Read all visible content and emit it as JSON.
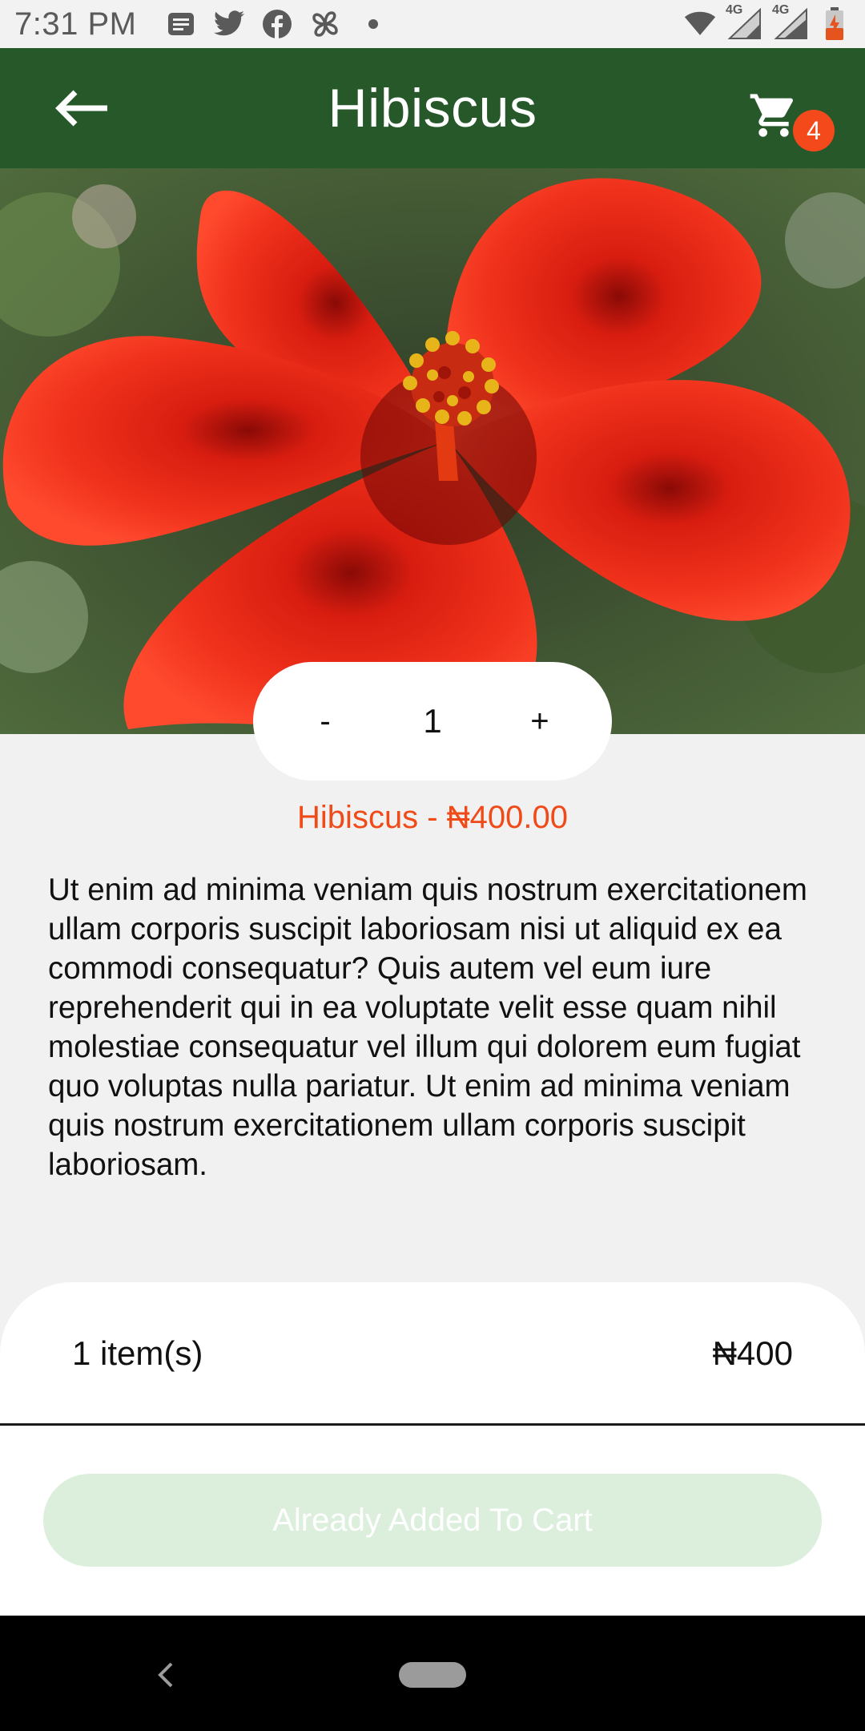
{
  "status_bar": {
    "time": "7:31 PM",
    "network_labels": [
      "4G",
      "4G"
    ],
    "icons": [
      "news-icon",
      "twitter-icon",
      "facebook-icon",
      "pinwheel-icon",
      "dot-icon",
      "wifi-icon",
      "signal-icon",
      "signal-icon",
      "battery-icon"
    ]
  },
  "app_bar": {
    "title": "Hibiscus",
    "cart_count": "4",
    "back_icon": "arrow-left-icon",
    "cart_icon": "shopping-cart-icon"
  },
  "quantity": {
    "decrement_label": "-",
    "value": "1",
    "increment_label": "+"
  },
  "product": {
    "title_price": "Hibiscus - ₦400.00",
    "description": "Ut enim ad minima veniam quis nostrum exercitationem ullam corporis suscipit laboriosam nisi ut aliquid ex ea commodi consequatur? Quis autem vel eum iure reprehenderit qui in ea voluptate velit esse quam nihil molestiae consequatur vel illum qui dolorem eum fugiat quo voluptas nulla pariatur. Ut enim ad minima veniam quis nostrum exercitationem ullam corporis suscipit laboriosam."
  },
  "summary": {
    "items_label": "1 item(s)",
    "total": "₦400"
  },
  "cta": {
    "label": "Already Added To Cart"
  },
  "colors": {
    "app_bar": "#27582a",
    "accent": "#ef4a18",
    "badge": "#f44a1b",
    "cta_disabled": "#dcefdd"
  }
}
